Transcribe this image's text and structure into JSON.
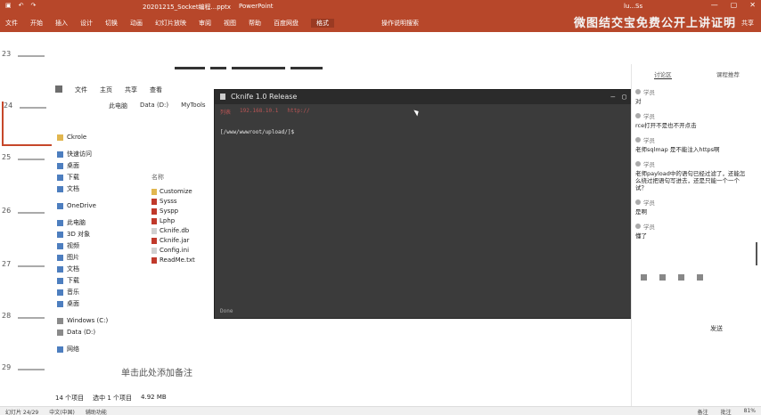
{
  "titlebar": {
    "file_title": "20201215_Socket编程...pptx",
    "app_name": "PowerPoint",
    "user": "lu...Ss"
  },
  "ribbon": {
    "tabs": [
      "文件",
      "开始",
      "插入",
      "设计",
      "切换",
      "动画",
      "幻灯片放映",
      "审阅",
      "视图",
      "帮助",
      "百度网盘",
      "格式"
    ],
    "active_tab": "格式",
    "tellme": "操作说明搜索",
    "share": "共享"
  },
  "banner": "微图结交宝免费公开上讲证明",
  "thumbnails": [
    {
      "num": "23"
    },
    {
      "num": "24"
    },
    {
      "num": "25"
    },
    {
      "num": "26"
    },
    {
      "num": "27"
    },
    {
      "num": "28"
    },
    {
      "num": "29"
    }
  ],
  "explorer": {
    "toolbar": [
      "文件",
      "主页",
      "共享",
      "查看"
    ],
    "path": [
      "此电脑",
      "Data (D:)",
      "MyTools"
    ],
    "nav": {
      "quick_access": "快速访问",
      "desktop": "桌面",
      "downloads": "下载",
      "documents": "文档",
      "onedrive": "OneDrive",
      "this_pc": "此电脑",
      "objects3d": "3D 对象",
      "videos": "视频",
      "pictures": "图片",
      "docs2": "文档",
      "downloads2": "下载",
      "music": "音乐",
      "desktop2": "桌面",
      "windows_c": "Windows (C:)",
      "data_d": "Data (D:)",
      "network": "网络",
      "ckrole": "Ckrole"
    },
    "column_header": "名称",
    "files": [
      "Customize",
      "Sysss",
      "Syspp",
      "Lphp",
      "Cknife.db",
      "Cknife.jar",
      "Config.ini",
      "ReadMe.txt"
    ],
    "status": [
      "14 个项目",
      "选中 1 个项目",
      "4.92 MB"
    ]
  },
  "slide_bottom_text": "单击此处添加备注",
  "terminal": {
    "title": "Cknife 1.0 Release",
    "tabs": [
      "列表",
      "192.168.10.1",
      "http://"
    ],
    "line": "[/www/wwwroot/upload/]$",
    "footer": "Done"
  },
  "chat": {
    "tabs": [
      "讨论区",
      "课程推荐"
    ],
    "active_tab": "讨论区",
    "messages": [
      {
        "who": "学员",
        "text": "对"
      },
      {
        "who": "学员",
        "text": "rce打开不是也不开点击"
      },
      {
        "who": "学员",
        "text": "老师sqlmap 是不能注入https啊"
      },
      {
        "who": "学员",
        "text": "老师payload中的语句已经过滤了，还能怎么绕过把语句写进去，还是只能一个一个试？"
      },
      {
        "who": "学员",
        "text": "是啊"
      },
      {
        "who": "学员",
        "text": "懂了"
      }
    ],
    "send_label": "发送"
  },
  "statusbar": {
    "left": [
      "幻灯片 24/29",
      "中文(中国)",
      "辅助功能"
    ],
    "right": [
      "备注",
      "批注",
      "81%"
    ]
  }
}
